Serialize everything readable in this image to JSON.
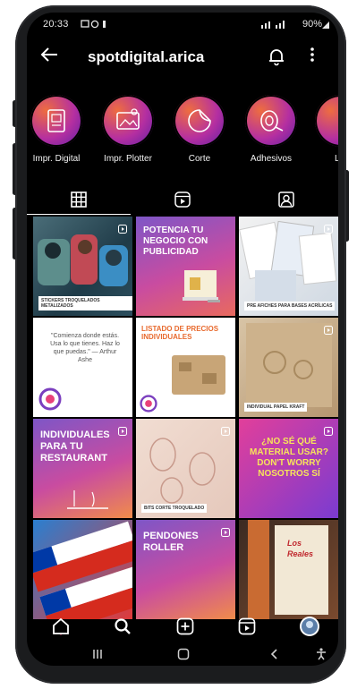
{
  "status_bar": {
    "time": "20:33",
    "right": "90%"
  },
  "header": {
    "back_icon": "arrow-left-icon",
    "handle": "spotdigital.arica",
    "bell_icon": "bell-icon",
    "more_icon": "more-vertical-icon"
  },
  "highlights": [
    {
      "label": "Impr. Digital",
      "icon": "document-icon"
    },
    {
      "label": "Impr. Plotter",
      "icon": "image-icon"
    },
    {
      "label": "Corte",
      "icon": "sticker-icon"
    },
    {
      "label": "Adhesivos",
      "icon": "tape-icon"
    },
    {
      "label": "Let",
      "icon": "letter-icon"
    }
  ],
  "tabs": [
    "grid-icon",
    "reels-icon",
    "tagged-icon"
  ],
  "posts": [
    {
      "caption": "STICKERS TROQUELADOS METALIZADOS"
    },
    {
      "caption": "POTENCIA TU NEGOCIO CON PUBLICIDAD"
    },
    {
      "caption": "PRE AFICHES PARA BASES ACRÍLICAS"
    },
    {
      "caption": "\"Comienza donde estás. Usa lo que tienes. Haz lo que puedas.\" — Arthur Ashe"
    },
    {
      "caption": "LISTADO DE PRECIOS INDIVIDUALES"
    },
    {
      "caption": "INDIVIDUAL PAPEL KRAFT"
    },
    {
      "caption": "INDIVIDUALES PARA TU RESTAURANT"
    },
    {
      "caption": "BITS CORTE TROQUELADO"
    },
    {
      "caption": "¿NO SÉ QUÉ MATERIAL USAR? DON'T WORRY NOSOTROS SÍ"
    },
    {
      "caption": ""
    },
    {
      "caption": "PENDONES ROLLER"
    },
    {
      "caption": "Los Reales"
    }
  ],
  "bottom_nav": [
    "home-icon",
    "search-icon",
    "add-post-icon",
    "reels-icon",
    "profile-avatar-icon"
  ],
  "system_nav": [
    "recents-icon",
    "home-button-icon",
    "back-button-icon",
    "accessibility-icon"
  ],
  "colors": {
    "accent_orange": "#f39a3c",
    "accent_purple": "#7b3fbf",
    "accent_pink": "#e8427a",
    "background": "#000000"
  }
}
